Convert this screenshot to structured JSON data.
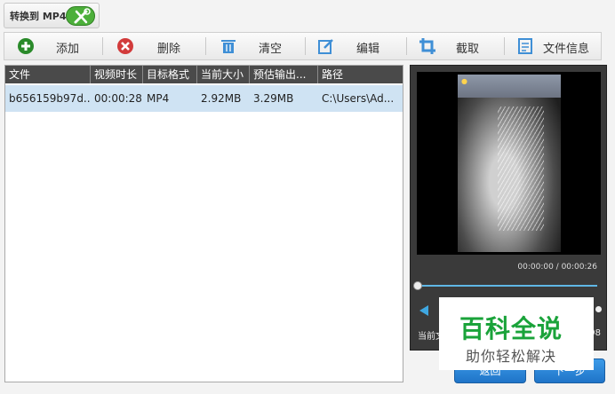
{
  "app": {
    "format_tag": "转换到 MP4"
  },
  "toolbar": {
    "add": "添加",
    "delete": "删除",
    "clear": "清空",
    "edit": "编辑",
    "crop": "截取",
    "file_info": "文件信息"
  },
  "file_table": {
    "columns": [
      "文件",
      "视频时长",
      "目标格式",
      "当前大小",
      "预估输出...",
      "路径"
    ],
    "rows": [
      {
        "file": "b656159b97d...",
        "duration": "00:00:28",
        "target_format": "MP4",
        "current_size": "2.92MB",
        "estimated_output": "3.29MB",
        "path": "C:\\Users\\Ad..."
      }
    ]
  },
  "preview": {
    "time": "00:00:00 / 00:00:26",
    "current_file_label": "当前文",
    "frame_fragment": "98",
    "seek_progress": 0
  },
  "buttons": {
    "back": "返回",
    "next": "下一步"
  },
  "watermark": {
    "title": "百科全说",
    "subtitle": "助你轻松解决"
  },
  "colors": {
    "accent_blue": "#1f74c8",
    "table_selection": "#cfe3f3",
    "header_dark": "#4a4a4a",
    "watermark_green": "#1aa33a"
  }
}
